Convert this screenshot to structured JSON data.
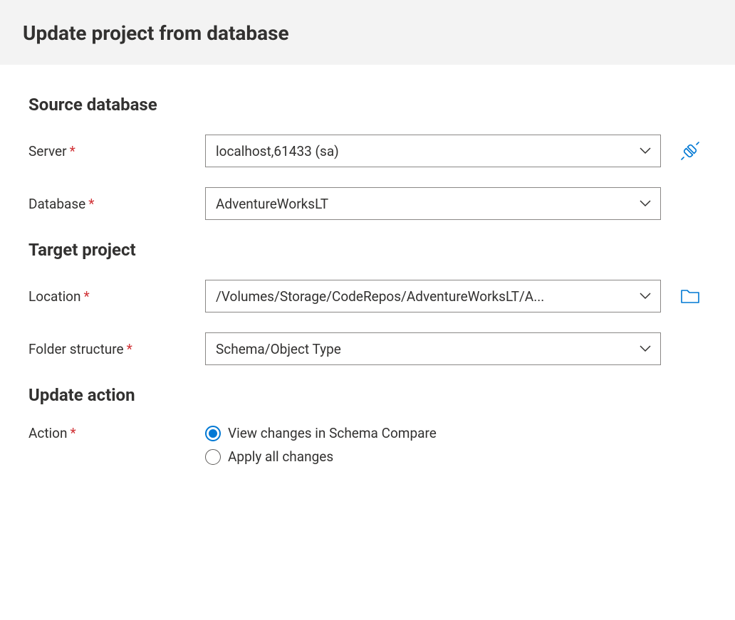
{
  "header": {
    "title": "Update project from database"
  },
  "sections": {
    "source": {
      "title": "Source database",
      "server": {
        "label": "Server",
        "value": "localhost,61433 (sa)"
      },
      "database": {
        "label": "Database",
        "value": "AdventureWorksLT"
      }
    },
    "target": {
      "title": "Target project",
      "location": {
        "label": "Location",
        "value": "/Volumes/Storage/CodeRepos/AdventureWorksLT/A..."
      },
      "folder_structure": {
        "label": "Folder structure",
        "value": "Schema/Object Type"
      }
    },
    "action": {
      "title": "Update action",
      "label": "Action",
      "options": {
        "view": "View changes in Schema Compare",
        "apply": "Apply all changes"
      },
      "selected": "view"
    }
  }
}
